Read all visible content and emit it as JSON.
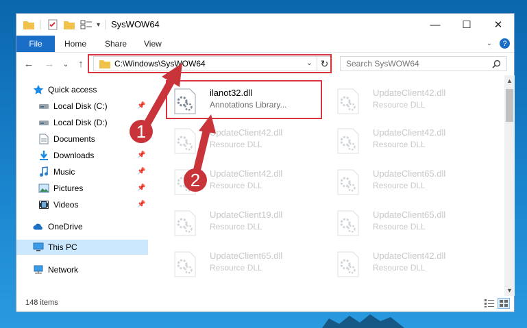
{
  "window": {
    "title": "SysWOW64",
    "controls": {
      "minimize": "—",
      "maximize": "☐",
      "close": "✕"
    }
  },
  "ribbon": {
    "tabs": [
      {
        "label": "File"
      },
      {
        "label": "Home"
      },
      {
        "label": "Share"
      },
      {
        "label": "View"
      }
    ],
    "help": "?"
  },
  "navigation": {
    "back": "←",
    "forward": "→",
    "recent": "⌄",
    "up": "↑",
    "address": "C:\\Windows\\SysWOW64",
    "refresh": "↻",
    "search_placeholder": "Search SysWOW64"
  },
  "nav_pane": {
    "items": [
      {
        "label": "Quick access",
        "icon": "star-icon"
      },
      {
        "label": "Local Disk (C:)",
        "icon": "drive-icon",
        "pinned": true
      },
      {
        "label": "Local Disk (D:)",
        "icon": "drive-icon"
      },
      {
        "label": "Documents",
        "icon": "documents-icon"
      },
      {
        "label": "Downloads",
        "icon": "downloads-icon",
        "pinned": true
      },
      {
        "label": "Music",
        "icon": "music-icon",
        "pinned": true
      },
      {
        "label": "Pictures",
        "icon": "pictures-icon",
        "pinned": true
      },
      {
        "label": "Videos",
        "icon": "videos-icon",
        "pinned": true
      },
      {
        "label": "OneDrive",
        "icon": "onedrive-icon"
      },
      {
        "label": "This PC",
        "icon": "pc-icon",
        "selected": true
      },
      {
        "label": "Network",
        "icon": "network-icon"
      }
    ]
  },
  "files": [
    {
      "name": "ilanot32.dll",
      "desc": "Annotations Library..."
    },
    {
      "name": "UpdateClient42.dll",
      "desc": "Resource DLL"
    },
    {
      "name": "UpdateClient42.dll",
      "desc": "Resource DLL"
    },
    {
      "name": "UpdateClient42.dll",
      "desc": "Resource DLL"
    },
    {
      "name": "UpdateClient42.dll",
      "desc": "Resource DLL"
    },
    {
      "name": "UpdateClient65.dll",
      "desc": "Resource DLL"
    },
    {
      "name": "UpdateClient19.dll",
      "desc": "Resource DLL"
    },
    {
      "name": "UpdateClient65.dll",
      "desc": "Resource DLL"
    },
    {
      "name": "UpdateClient65.dll",
      "desc": "Resource DLL"
    },
    {
      "name": "UpdateClient42.dll",
      "desc": "Resource DLL"
    }
  ],
  "status": {
    "items_count": "148 items"
  },
  "annotations": {
    "step1": "1",
    "step2": "2",
    "highlight_color": "#d9343d"
  }
}
